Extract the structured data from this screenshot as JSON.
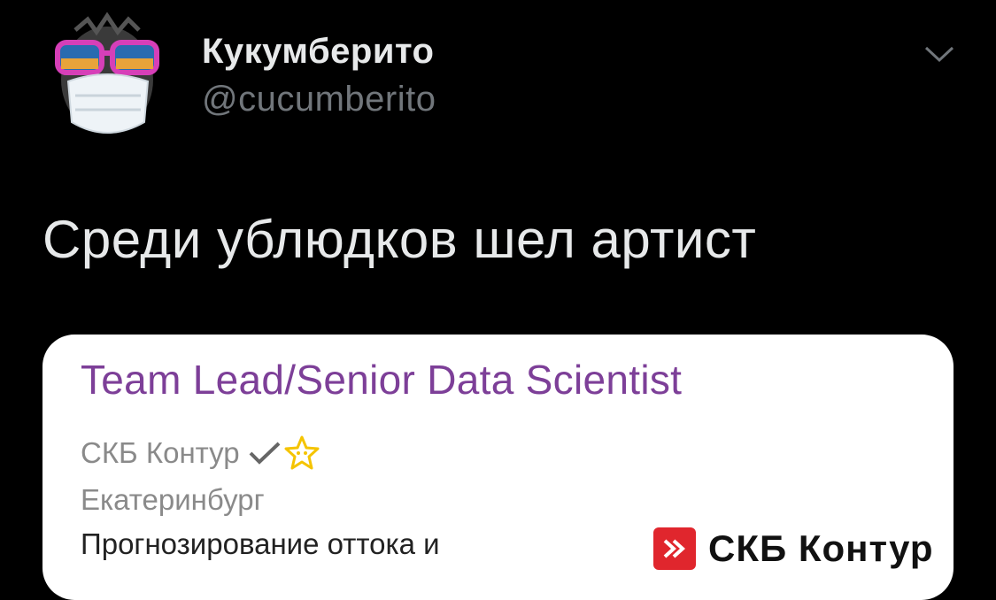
{
  "tweet": {
    "author": {
      "display_name": "Кукумберито",
      "handle": "@cucumberito",
      "avatar_icon": "masked-animal-avatar-icon"
    },
    "menu_icon": "chevron-down-icon",
    "text": "Среди ублюдков шел артист"
  },
  "job_card": {
    "title": "Team Lead/Senior Data Scientist",
    "company": "СКБ Контур",
    "verified_icon": "checkmark-icon",
    "badge_icon": "star-icon",
    "city": "Екатеринбург",
    "description": "Прогнозирование оттока и",
    "logo_text": "СКБ Контур",
    "colors": {
      "title": "#7d3f98",
      "badge": "#f5c400",
      "logo_red": "#e0262d"
    }
  }
}
